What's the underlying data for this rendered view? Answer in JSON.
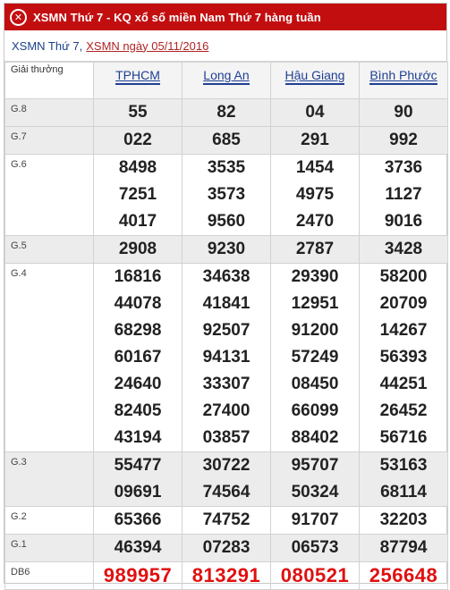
{
  "header": {
    "logo_glyph": "✕",
    "logo_icon": "xsmn-logo-icon",
    "title": "XSMN Thứ 7 - KQ xổ số miền Nam Thứ 7 hàng tuần",
    "bg_color": "#c30e10"
  },
  "subtitle": {
    "prefix": "XSMN Thứ 7,",
    "link": "XSMN ngày 05/11/2016"
  },
  "table": {
    "prize_header": "Giải thưởng",
    "provinces": [
      "TPHCM",
      "Long An",
      "Hậu Giang",
      "Bình Phước"
    ],
    "rows": [
      {
        "name": "G.8",
        "values": [
          [
            "55"
          ],
          [
            "82"
          ],
          [
            "04"
          ],
          [
            "90"
          ]
        ]
      },
      {
        "name": "G.7",
        "values": [
          [
            "022"
          ],
          [
            "685"
          ],
          [
            "291"
          ],
          [
            "992"
          ]
        ]
      },
      {
        "name": "G.6",
        "values": [
          [
            "8498",
            "7251",
            "4017"
          ],
          [
            "3535",
            "3573",
            "9560"
          ],
          [
            "1454",
            "4975",
            "2470"
          ],
          [
            "3736",
            "1127",
            "9016"
          ]
        ]
      },
      {
        "name": "G.5",
        "values": [
          [
            "2908"
          ],
          [
            "9230"
          ],
          [
            "2787"
          ],
          [
            "3428"
          ]
        ]
      },
      {
        "name": "G.4",
        "values": [
          [
            "16816",
            "44078",
            "68298",
            "60167",
            "24640",
            "82405",
            "43194"
          ],
          [
            "34638",
            "41841",
            "92507",
            "94131",
            "33307",
            "27400",
            "03857"
          ],
          [
            "29390",
            "12951",
            "91200",
            "57249",
            "08450",
            "66099",
            "88402"
          ],
          [
            "58200",
            "20709",
            "14267",
            "56393",
            "44251",
            "26452",
            "56716"
          ]
        ]
      },
      {
        "name": "G.3",
        "values": [
          [
            "55477",
            "09691"
          ],
          [
            "30722",
            "74564"
          ],
          [
            "95707",
            "50324"
          ],
          [
            "53163",
            "68114"
          ]
        ]
      },
      {
        "name": "G.2",
        "values": [
          [
            "65366"
          ],
          [
            "74752"
          ],
          [
            "91707"
          ],
          [
            "32203"
          ]
        ]
      },
      {
        "name": "G.1",
        "values": [
          [
            "46394"
          ],
          [
            "07283"
          ],
          [
            "06573"
          ],
          [
            "87794"
          ]
        ]
      },
      {
        "name": "DB6",
        "values": [
          [
            "989957"
          ],
          [
            "813291"
          ],
          [
            "080521"
          ],
          [
            "256648"
          ]
        ]
      }
    ],
    "special_color": "#e01010",
    "shade_color": "#ececec"
  }
}
